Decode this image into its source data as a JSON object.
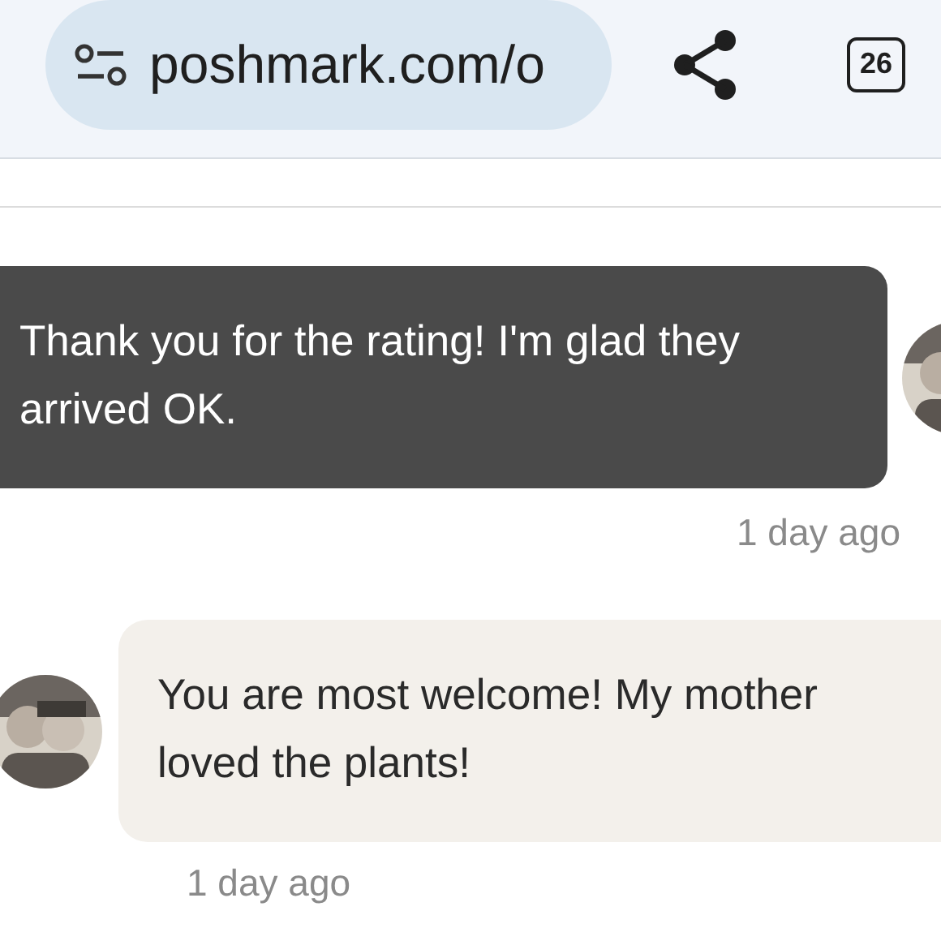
{
  "browser_bar": {
    "url": "poshmark.com/o",
    "tab_count": "26"
  },
  "messages": [
    {
      "kind": "outgoing",
      "text": "Thank you for the rating! I'm glad they arrived OK.",
      "time": "1 day ago"
    },
    {
      "kind": "incoming",
      "text": "You are most welcome! My mother loved the plants!",
      "time": "1 day ago"
    }
  ]
}
